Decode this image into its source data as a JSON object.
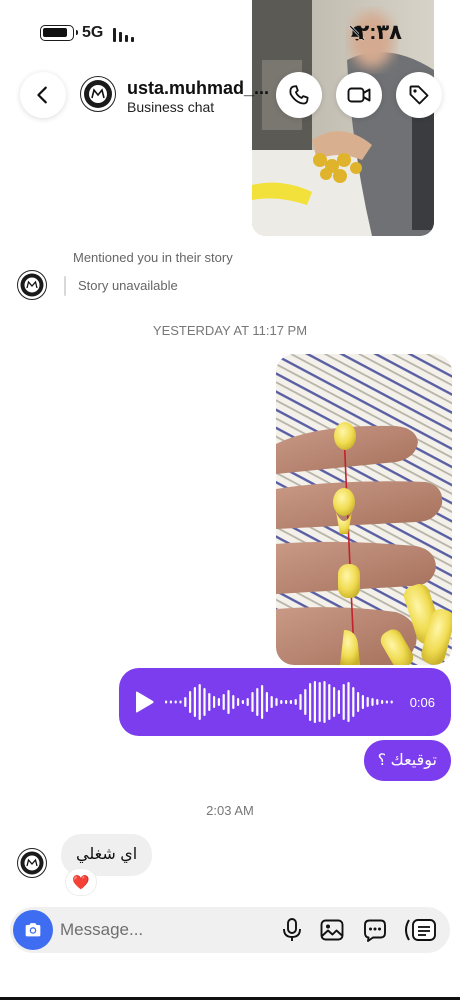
{
  "status_bar": {
    "network": "5G",
    "time": "٢:٣٨"
  },
  "header": {
    "username": "usta.muhmad_...",
    "subtitle": "Business chat",
    "icons": [
      "back-icon",
      "phone-icon",
      "video-icon",
      "tag-icon"
    ]
  },
  "mention": {
    "caption": "Mentioned you in their story",
    "story_status": "Story unavailable"
  },
  "thread": {
    "timestamp_1": "YESTERDAY AT 11:17 PM",
    "voice_duration": "0:06",
    "outgoing_text": "توقيعك ؟",
    "timestamp_2": "2:03 AM",
    "incoming_text": "اي شغلي",
    "reaction": "❤️"
  },
  "composer": {
    "placeholder": "Message...",
    "icons": [
      "camera-icon",
      "microphone-icon",
      "gallery-icon",
      "sticker-icon",
      "more-icon"
    ]
  },
  "colors": {
    "accent": "#7c3dee",
    "camera_button": "#3f6df2",
    "incoming_bubble": "#efefef"
  }
}
